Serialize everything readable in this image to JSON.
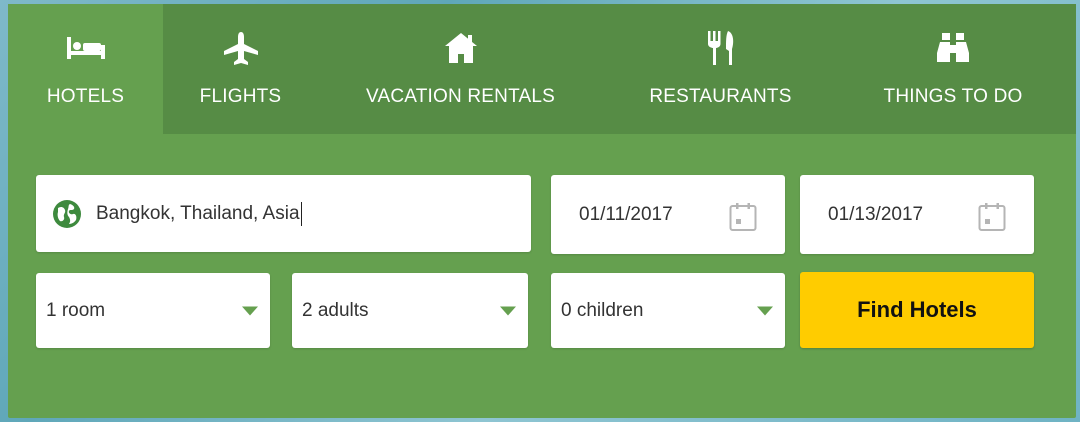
{
  "tabs": [
    {
      "label": "HOTELS",
      "icon": "bed-icon",
      "active": true
    },
    {
      "label": "FLIGHTS",
      "icon": "airplane-icon",
      "active": false
    },
    {
      "label": "VACATION RENTALS",
      "icon": "house-icon",
      "active": false
    },
    {
      "label": "RESTAURANTS",
      "icon": "fork-knife-icon",
      "active": false
    },
    {
      "label": "THINGS TO DO",
      "icon": "binoculars-icon",
      "active": false
    }
  ],
  "search": {
    "destination_value": "Bangkok, Thailand, Asia",
    "destination_icon": "globe-icon",
    "checkin_value": "01/11/2017",
    "checkout_value": "01/13/2017",
    "calendar_icon": "calendar-icon"
  },
  "selectors": {
    "rooms": "1 room",
    "adults": "2 adults",
    "children": "0 children"
  },
  "find_button_label": "Find Hotels",
  "colors": {
    "widget_green": "#65a04f",
    "tab_bar_green": "#568c45",
    "button_yellow": "#ffcc00"
  }
}
